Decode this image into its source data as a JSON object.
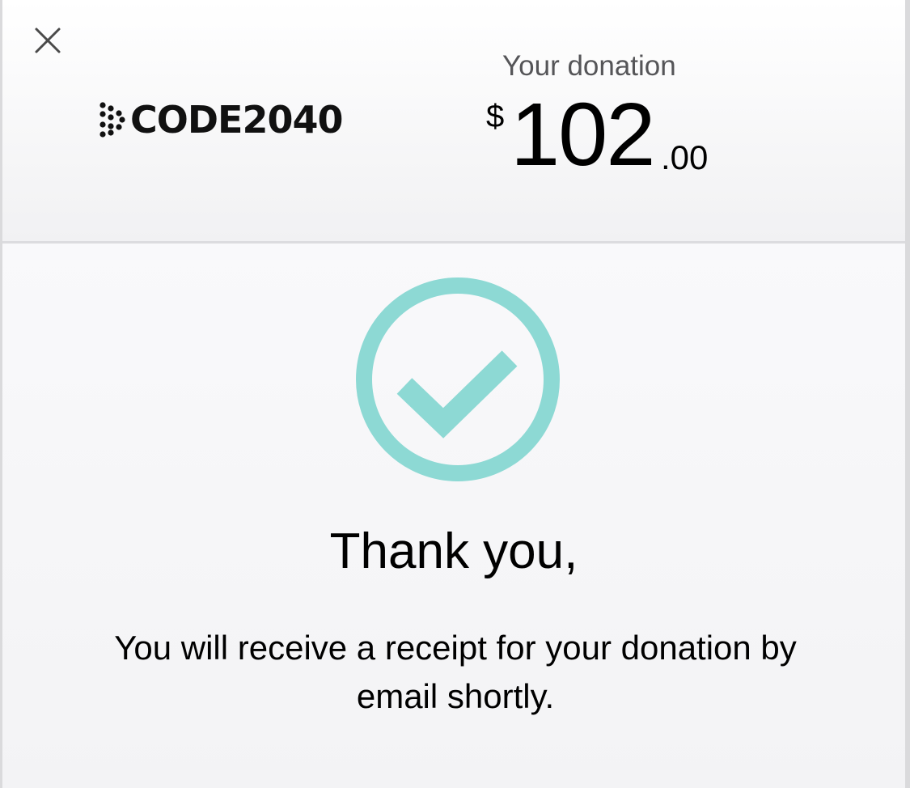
{
  "header": {
    "close_icon": "close-icon",
    "logo": {
      "text": "CODE2040",
      "icon": "dot-arrow-logo-icon"
    },
    "donation_label": "Your donation",
    "amount": {
      "currency": "$",
      "major": "102",
      "minor": ".00"
    }
  },
  "main": {
    "status_icon": "checkmark-circle-icon",
    "title": "Thank you,",
    "message": "You will receive a receipt for your donation by email shortly."
  },
  "colors": {
    "accent": "#8dd9d4",
    "text": "#000000",
    "muted_text": "#555558",
    "border": "#dadadc"
  }
}
